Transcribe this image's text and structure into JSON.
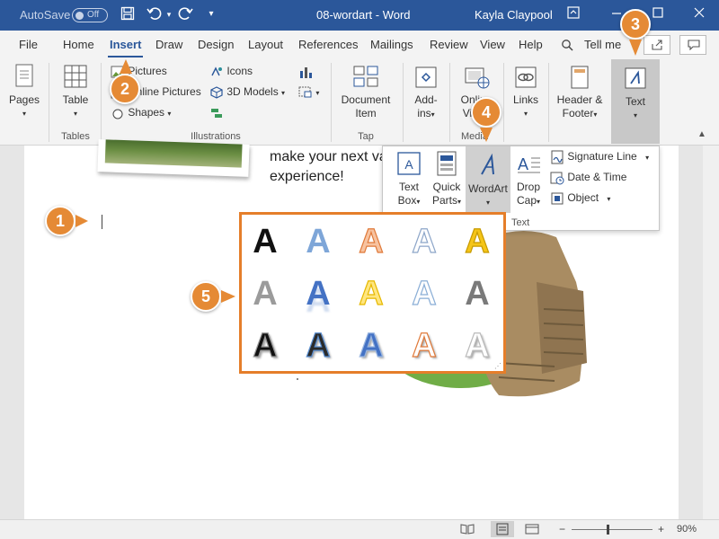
{
  "titlebar": {
    "autosave_label": "AutoSave",
    "autosave_state": "Off",
    "doc_title": "08-wordart - Word",
    "user_name": "Kayla Claypool",
    "icons": [
      "save-icon",
      "undo-icon",
      "redo-icon",
      "customize-icon",
      "ribbon-display-icon",
      "minimize-icon",
      "maximize-icon",
      "close-icon"
    ]
  },
  "tabs": [
    "File",
    "Home",
    "Insert",
    "Draw",
    "Design",
    "Layout",
    "References",
    "Mailings",
    "Review",
    "View",
    "Help"
  ],
  "active_tab": "Insert",
  "tell_me": "Tell me",
  "ribbon": {
    "pages": "Pages",
    "table": "Table",
    "tables_group": "Tables",
    "pictures": "Pictures",
    "online_pictures": "Online Pictures",
    "shapes": "Shapes",
    "icons": "Icons",
    "models3d": "3D Models",
    "illustrations_group": "Illustrations",
    "document_item_line1": "Document",
    "document_item_line2": "Item",
    "tap_group": "Tap",
    "addins_line1": "Add-",
    "addins_line2": "ins",
    "online_video_line1": "Online",
    "online_video_line2": "Video",
    "media_group": "Media",
    "links": "Links",
    "header_footer_line1": "Header &",
    "header_footer_line2": "Footer",
    "text": "Text"
  },
  "text_panel": {
    "text_box_line1": "Text",
    "text_box_line2": "Box",
    "quick_parts_line1": "Quick",
    "quick_parts_line2": "Parts",
    "wordart": "WordArt",
    "drop_cap_line1": "Drop",
    "drop_cap_line2": "Cap",
    "signature_line": "Signature Line",
    "date_time": "Date & Time",
    "object": "Object",
    "group_label": "Text"
  },
  "document": {
    "text_line1": "make your next va",
    "text_line2": "experience!"
  },
  "wordart_gallery": {
    "letter": "A",
    "styles": [
      {
        "fill": "#111111",
        "stroke": "none"
      },
      {
        "fill": "#7ea6d8",
        "stroke": "none"
      },
      {
        "fill": "#f7c3a0",
        "stroke": "#e07a3a"
      },
      {
        "fill": "#ffffff",
        "stroke": "#8da6c9"
      },
      {
        "fill": "#f5c518",
        "stroke": "#c79a00"
      },
      {
        "fill": "#9b9b9b",
        "stroke": "none"
      },
      {
        "fill": "#4472c4",
        "stroke": "none"
      },
      {
        "fill": "#ffe680",
        "stroke": "#e6b800"
      },
      {
        "fill": "#ffffff",
        "stroke": "#8aaed6"
      },
      {
        "fill": "#7a7a7a",
        "stroke": "none"
      },
      {
        "fill": "#111111",
        "stroke": "#999999"
      },
      {
        "fill": "#2a2a2a",
        "stroke": "#5a8ed0"
      },
      {
        "fill": "#4472c4",
        "stroke": "#9ab6e0"
      },
      {
        "fill": "#ffffff",
        "stroke": "#e07a3a"
      },
      {
        "fill": "#ffffff",
        "stroke": "#bbbbbb"
      }
    ]
  },
  "callouts": [
    "1",
    "2",
    "3",
    "4",
    "5"
  ],
  "statusbar": {
    "zoom": "90%",
    "zoom_value": 0.9
  },
  "colors": {
    "word_blue": "#2b579a",
    "callout_orange": "#e58a35",
    "gallery_border": "#e57e2a",
    "ribbon_bg": "#f3f3f3",
    "highlight": "#c8c8c8"
  }
}
